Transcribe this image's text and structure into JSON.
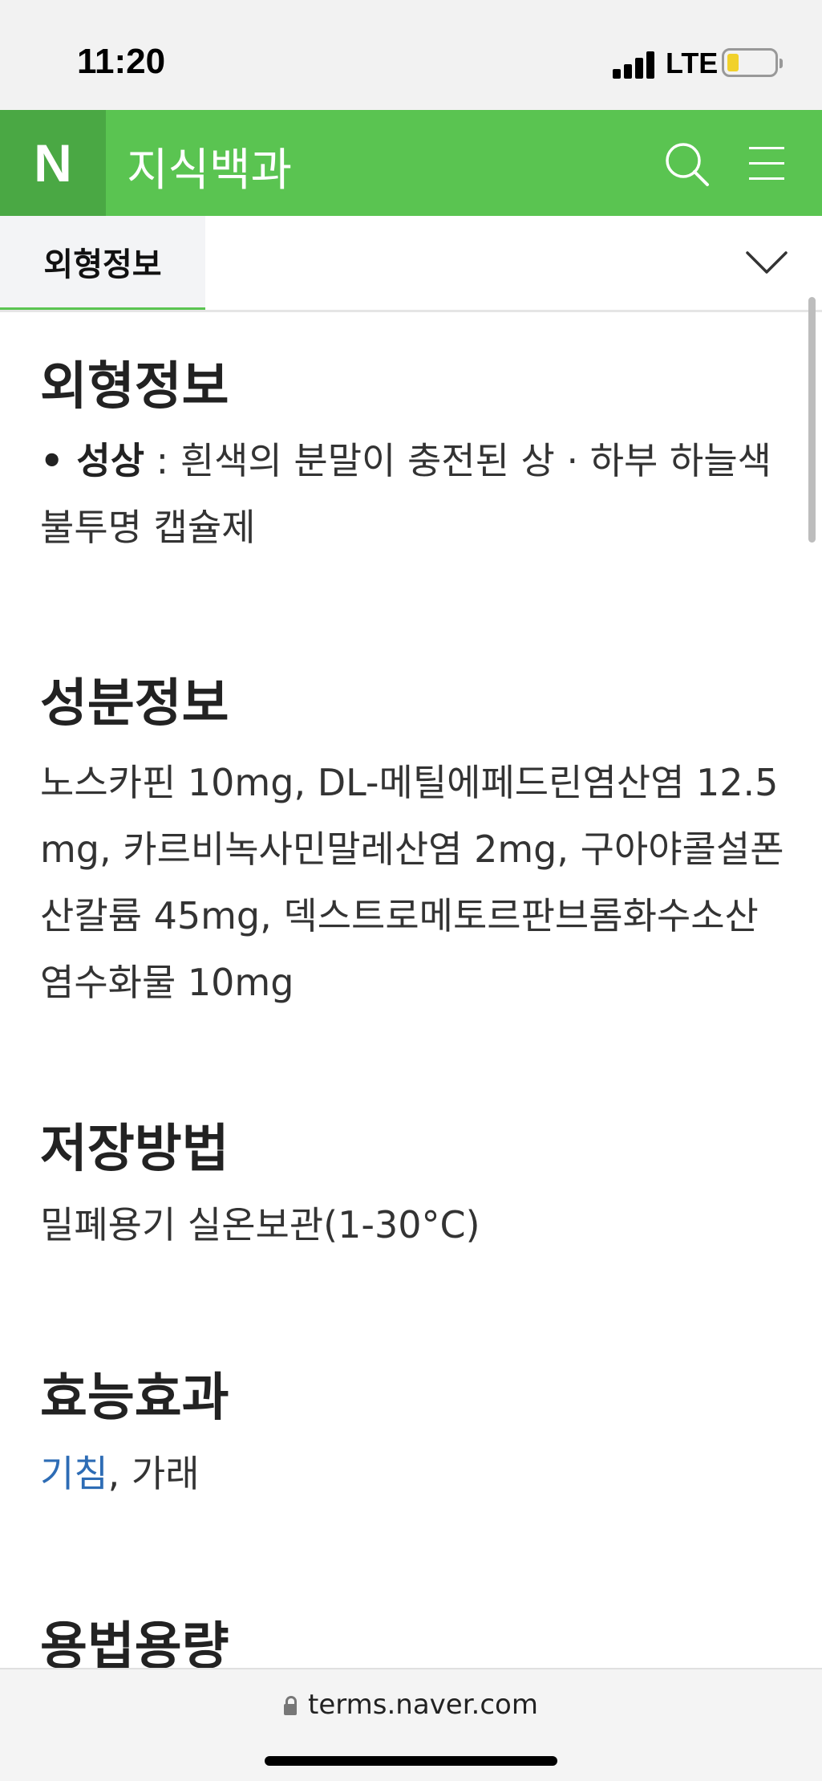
{
  "status": {
    "time": "11:20",
    "network": "LTE"
  },
  "nav": {
    "logo": "N",
    "title": "지식백과"
  },
  "tab": {
    "active_label": "외형정보"
  },
  "sections": {
    "appearance": {
      "heading": "외형정보",
      "bullet": "• 성상",
      "text": " : 흰색의 분말이 충전된 상 · 하부 하늘색 불투명 캡슐제"
    },
    "ingredients": {
      "heading": "성분정보",
      "text": "노스카핀 10mg, DL-메틸에페드린염산염 12.5 mg, 카르비녹사민말레산염 2mg, 구아야콜설폰산칼륨 45mg, 덱스트로메토르판브롬화수소산염수화물 10mg"
    },
    "storage": {
      "heading": "저장방법",
      "text": "밀폐용기 실온보관(1-30°C)"
    },
    "efficacy": {
      "heading": "효능효과",
      "link": "기침",
      "rest": ", 가래"
    },
    "dosage": {
      "heading": "용법용량"
    }
  },
  "browser": {
    "url": "terms.naver.com"
  },
  "colors": {
    "brand_green": "#5ac451",
    "logo_green": "#4aa844",
    "link_blue": "#2d6cb5"
  },
  "icons": [
    "search-icon",
    "menu-icon",
    "chevron-down-icon",
    "lock-icon"
  ]
}
